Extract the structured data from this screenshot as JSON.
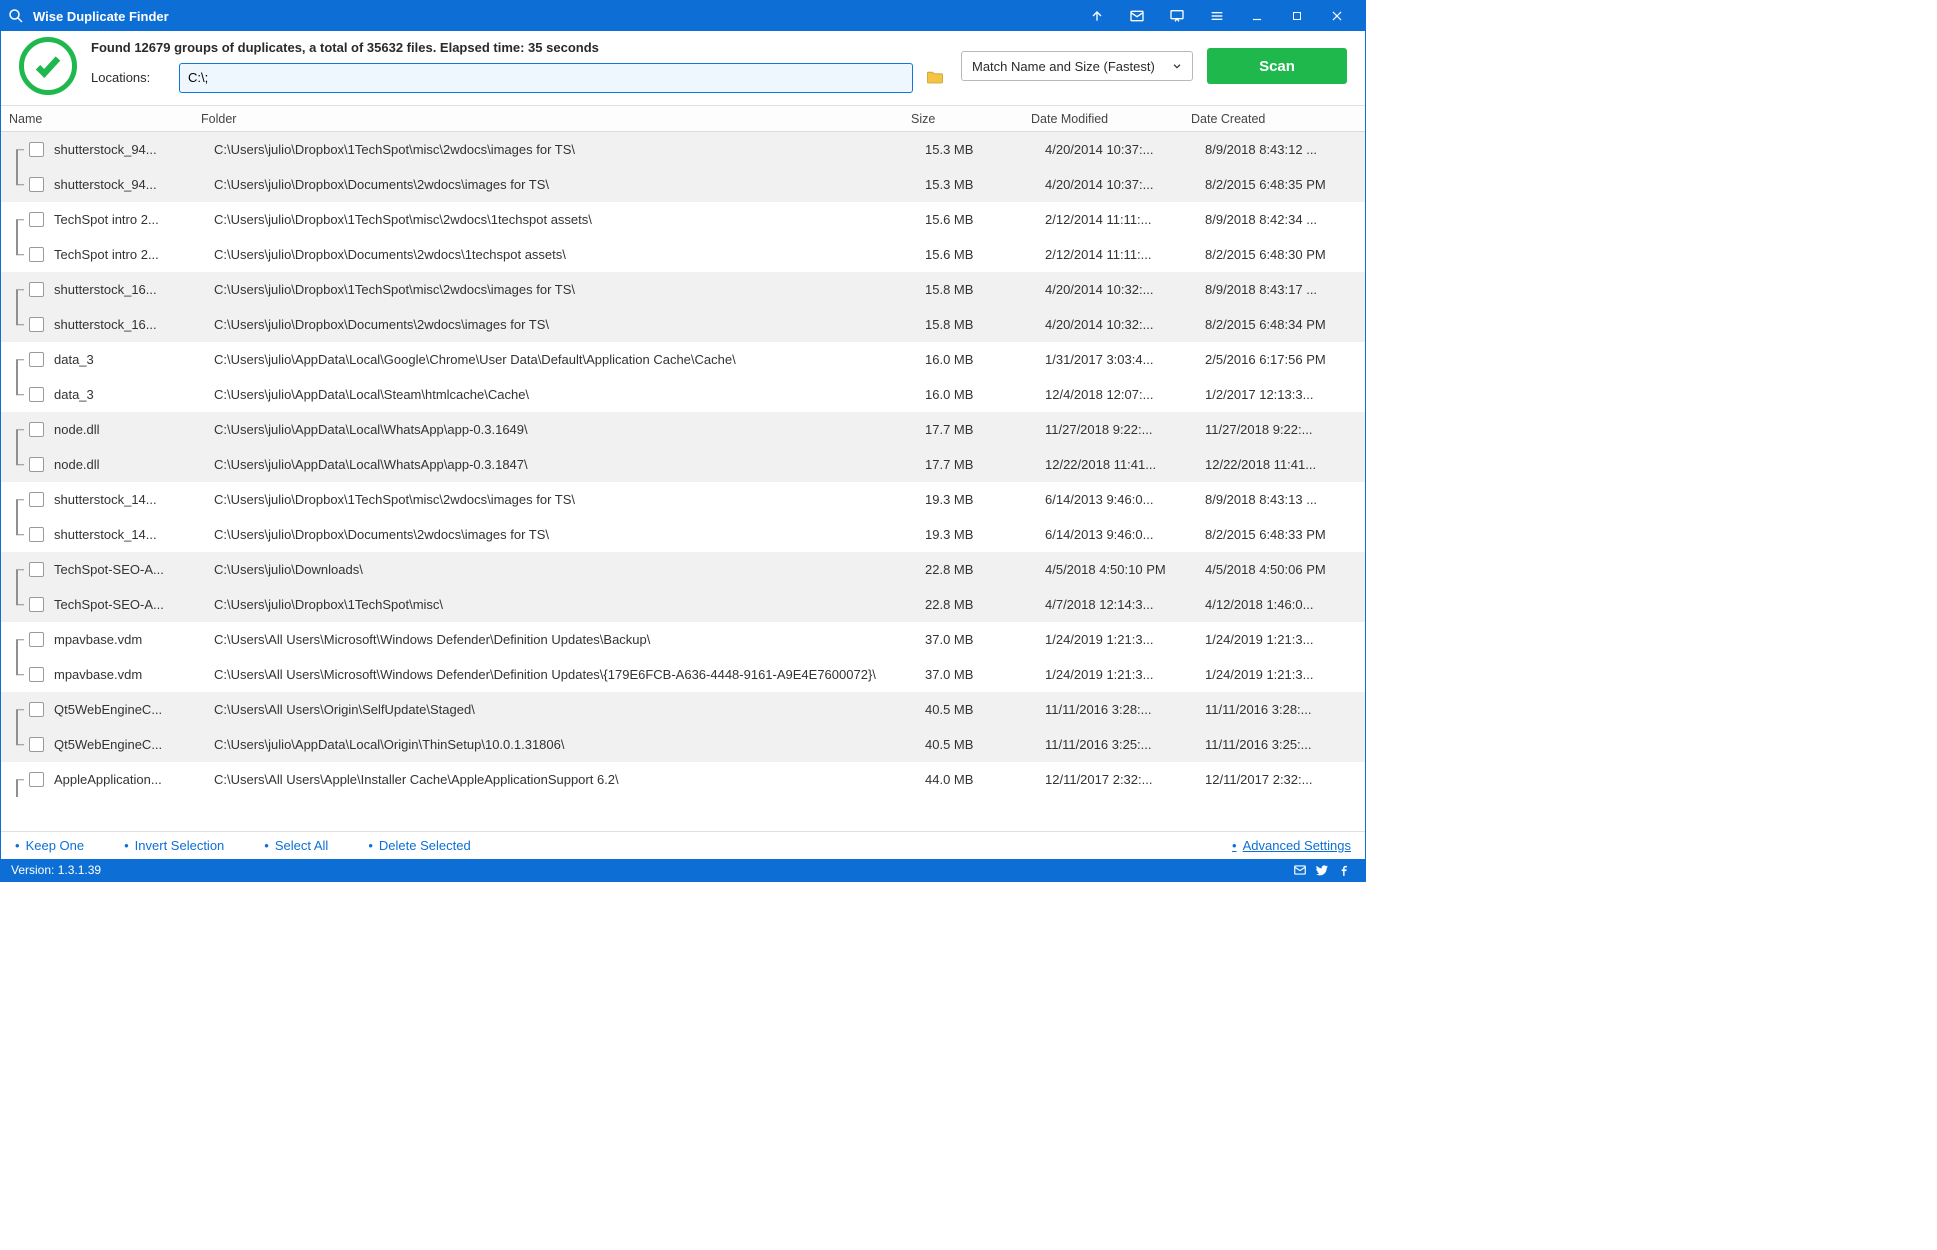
{
  "titlebar": {
    "title": "Wise Duplicate Finder"
  },
  "summary": "Found 12679 groups of duplicates, a total of 35632 files. Elapsed time: 35 seconds",
  "locations_label": "Locations:",
  "locations_value": "C:\\;",
  "match_mode": "Match Name and Size (Fastest)",
  "scan_label": "Scan",
  "columns": {
    "name": "Name",
    "folder": "Folder",
    "size": "Size",
    "modified": "Date Modified",
    "created": "Date Created"
  },
  "groups": [
    {
      "rows": [
        {
          "name": "shutterstock_94...",
          "folder": "C:\\Users\\julio\\Dropbox\\1TechSpot\\misc\\2wdocs\\images for TS\\",
          "size": "15.3 MB",
          "modified": "4/20/2014 10:37:...",
          "created": "8/9/2018 8:43:12 ..."
        },
        {
          "name": "shutterstock_94...",
          "folder": "C:\\Users\\julio\\Dropbox\\Documents\\2wdocs\\images for TS\\",
          "size": "15.3 MB",
          "modified": "4/20/2014 10:37:...",
          "created": "8/2/2015 6:48:35 PM"
        }
      ]
    },
    {
      "rows": [
        {
          "name": "TechSpot intro 2...",
          "folder": "C:\\Users\\julio\\Dropbox\\1TechSpot\\misc\\2wdocs\\1techspot assets\\",
          "size": "15.6 MB",
          "modified": "2/12/2014 11:11:...",
          "created": "8/9/2018 8:42:34 ..."
        },
        {
          "name": "TechSpot intro 2...",
          "folder": "C:\\Users\\julio\\Dropbox\\Documents\\2wdocs\\1techspot assets\\",
          "size": "15.6 MB",
          "modified": "2/12/2014 11:11:...",
          "created": "8/2/2015 6:48:30 PM"
        }
      ]
    },
    {
      "rows": [
        {
          "name": "shutterstock_16...",
          "folder": "C:\\Users\\julio\\Dropbox\\1TechSpot\\misc\\2wdocs\\images for TS\\",
          "size": "15.8 MB",
          "modified": "4/20/2014 10:32:...",
          "created": "8/9/2018 8:43:17 ..."
        },
        {
          "name": "shutterstock_16...",
          "folder": "C:\\Users\\julio\\Dropbox\\Documents\\2wdocs\\images for TS\\",
          "size": "15.8 MB",
          "modified": "4/20/2014 10:32:...",
          "created": "8/2/2015 6:48:34 PM"
        }
      ]
    },
    {
      "rows": [
        {
          "name": "data_3",
          "folder": "C:\\Users\\julio\\AppData\\Local\\Google\\Chrome\\User Data\\Default\\Application Cache\\Cache\\",
          "size": "16.0 MB",
          "modified": "1/31/2017 3:03:4...",
          "created": "2/5/2016 6:17:56 PM"
        },
        {
          "name": "data_3",
          "folder": "C:\\Users\\julio\\AppData\\Local\\Steam\\htmlcache\\Cache\\",
          "size": "16.0 MB",
          "modified": "12/4/2018 12:07:...",
          "created": "1/2/2017 12:13:3..."
        }
      ]
    },
    {
      "rows": [
        {
          "name": "node.dll",
          "folder": "C:\\Users\\julio\\AppData\\Local\\WhatsApp\\app-0.3.1649\\",
          "size": "17.7 MB",
          "modified": "11/27/2018 9:22:...",
          "created": "11/27/2018 9:22:..."
        },
        {
          "name": "node.dll",
          "folder": "C:\\Users\\julio\\AppData\\Local\\WhatsApp\\app-0.3.1847\\",
          "size": "17.7 MB",
          "modified": "12/22/2018 11:41...",
          "created": "12/22/2018 11:41..."
        }
      ]
    },
    {
      "rows": [
        {
          "name": "shutterstock_14...",
          "folder": "C:\\Users\\julio\\Dropbox\\1TechSpot\\misc\\2wdocs\\images for TS\\",
          "size": "19.3 MB",
          "modified": "6/14/2013 9:46:0...",
          "created": "8/9/2018 8:43:13 ..."
        },
        {
          "name": "shutterstock_14...",
          "folder": "C:\\Users\\julio\\Dropbox\\Documents\\2wdocs\\images for TS\\",
          "size": "19.3 MB",
          "modified": "6/14/2013 9:46:0...",
          "created": "8/2/2015 6:48:33 PM"
        }
      ]
    },
    {
      "rows": [
        {
          "name": "TechSpot-SEO-A...",
          "folder": "C:\\Users\\julio\\Downloads\\",
          "size": "22.8 MB",
          "modified": "4/5/2018 4:50:10 PM",
          "created": "4/5/2018 4:50:06 PM"
        },
        {
          "name": "TechSpot-SEO-A...",
          "folder": "C:\\Users\\julio\\Dropbox\\1TechSpot\\misc\\",
          "size": "22.8 MB",
          "modified": "4/7/2018 12:14:3...",
          "created": "4/12/2018 1:46:0..."
        }
      ]
    },
    {
      "rows": [
        {
          "name": "mpavbase.vdm",
          "folder": "C:\\Users\\All Users\\Microsoft\\Windows Defender\\Definition Updates\\Backup\\",
          "size": "37.0 MB",
          "modified": "1/24/2019 1:21:3...",
          "created": "1/24/2019 1:21:3..."
        },
        {
          "name": "mpavbase.vdm",
          "folder": "C:\\Users\\All Users\\Microsoft\\Windows Defender\\Definition Updates\\{179E6FCB-A636-4448-9161-A9E4E7600072}\\",
          "size": "37.0 MB",
          "modified": "1/24/2019 1:21:3...",
          "created": "1/24/2019 1:21:3..."
        }
      ]
    },
    {
      "rows": [
        {
          "name": "Qt5WebEngineC...",
          "folder": "C:\\Users\\All Users\\Origin\\SelfUpdate\\Staged\\",
          "size": "40.5 MB",
          "modified": "11/11/2016 3:28:...",
          "created": "11/11/2016 3:28:..."
        },
        {
          "name": "Qt5WebEngineC...",
          "folder": "C:\\Users\\julio\\AppData\\Local\\Origin\\ThinSetup\\10.0.1.31806\\",
          "size": "40.5 MB",
          "modified": "11/11/2016 3:25:...",
          "created": "11/11/2016 3:25:..."
        }
      ]
    },
    {
      "rows": [
        {
          "name": "AppleApplication...",
          "folder": "C:\\Users\\All Users\\Apple\\Installer Cache\\AppleApplicationSupport 6.2\\",
          "size": "44.0 MB",
          "modified": "12/11/2017 2:32:...",
          "created": "12/11/2017 2:32:..."
        }
      ]
    }
  ],
  "actions": {
    "keep_one": "Keep One",
    "invert": "Invert Selection",
    "select_all": "Select All",
    "delete": "Delete Selected",
    "advanced": "Advanced Settings"
  },
  "version_label": "Version: 1.3.1.39"
}
